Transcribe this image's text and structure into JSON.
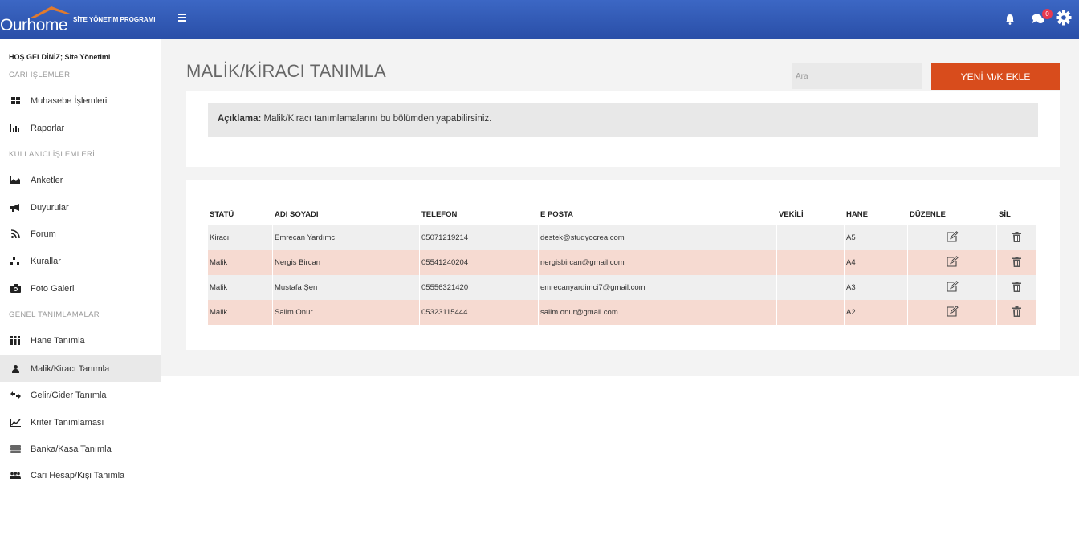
{
  "header": {
    "logo_text": "Ourhome",
    "logo_subtitle": "SİTE YÖNETİM PROGRAMI",
    "notification_count": "0"
  },
  "sidebar": {
    "welcome": "HOŞ GELDİNİZ; Site Yönetimi",
    "sections": [
      {
        "title": "CARİ İŞLEMLER",
        "items": [
          {
            "label": "Muhasebe İşlemleri",
            "icon": "dashboard-icon"
          },
          {
            "label": "Raporlar",
            "icon": "bar-chart-icon"
          }
        ]
      },
      {
        "title": "KULLANICI İŞLEMLERİ",
        "items": [
          {
            "label": "Anketler",
            "icon": "area-chart-icon"
          },
          {
            "label": "Duyurular",
            "icon": "bullhorn-icon"
          },
          {
            "label": "Forum",
            "icon": "feed-icon"
          },
          {
            "label": "Kurallar",
            "icon": "sitemap-icon"
          },
          {
            "label": "Foto Galeri",
            "icon": "camera-icon"
          }
        ]
      },
      {
        "title": "GENEL TANIMLAMALAR",
        "items": [
          {
            "label": "Hane Tanımla",
            "icon": "grid-icon"
          },
          {
            "label": "Malik/Kiracı Tanımla",
            "icon": "user-icon",
            "active": true
          },
          {
            "label": "Gelir/Gider Tanımla",
            "icon": "exchange-icon"
          },
          {
            "label": "Kriter Tanımlaması",
            "icon": "line-chart-icon"
          },
          {
            "label": "Banka/Kasa Tanımla",
            "icon": "money-icon"
          },
          {
            "label": "Cari Hesap/Kişi Tanımla",
            "icon": "users-icon"
          }
        ]
      }
    ]
  },
  "main": {
    "title": "MALİK/KİRACI TANIMLA",
    "search_placeholder": "Ara",
    "add_button": "YENİ M/K EKLE",
    "description_label": "Açıklama:",
    "description_text": " Malik/Kiracı tanımlamalarını bu bölümden yapabilirsiniz."
  },
  "table": {
    "headers": [
      "STATÜ",
      "ADI SOYADI",
      "TELEFON",
      "E POSTA",
      "VEKİLİ",
      "HANE",
      "DÜZENLE",
      "SİL"
    ],
    "rows": [
      {
        "status": "Kiracı",
        "name": "Emrecan Yardımcı",
        "phone": "05071219214",
        "email": "destek@studyocrea.com",
        "proxy": "",
        "unit": "A5"
      },
      {
        "status": "Malik",
        "name": "Nergis Bircan",
        "phone": "05541240204",
        "email": "nergisbircan@gmail.com",
        "proxy": "",
        "unit": "A4"
      },
      {
        "status": "Malik",
        "name": "Mustafa Şen",
        "phone": "05556321420",
        "email": "emrecanyardimci7@gmail.com",
        "proxy": "",
        "unit": "A3"
      },
      {
        "status": "Malik",
        "name": "Salim Onur",
        "phone": "05323115444",
        "email": "salim.onur@gmail.com",
        "proxy": "",
        "unit": "A2"
      }
    ]
  },
  "colors": {
    "header_blue": "#2f57b3",
    "accent_orange": "#d84c1c",
    "row_alt": "#f6dad1"
  }
}
